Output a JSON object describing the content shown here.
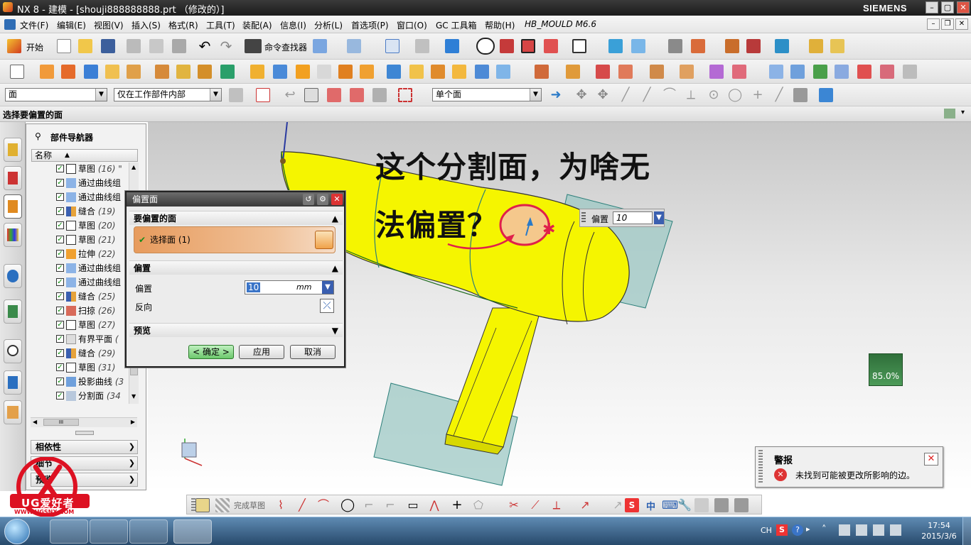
{
  "window": {
    "title": "NX 8 - 建模 - [shouji888888888.prt （修改的）]",
    "brand": "SIEMENS",
    "min": "–",
    "max": "▢",
    "close": "✕"
  },
  "menu": [
    "文件(F)",
    "编辑(E)",
    "视图(V)",
    "插入(S)",
    "格式(R)",
    "工具(T)",
    "装配(A)",
    "信息(I)",
    "分析(L)",
    "首选项(P)",
    "窗口(O)",
    "GC 工具箱",
    "帮助(H)",
    "HB_MOULD M6.6"
  ],
  "toolbar": {
    "start_label": "开始",
    "cmd_finder_label": "命令查找器"
  },
  "selection_bar": {
    "filter_value": "面",
    "scope_value": "仅在工作部件内部",
    "face_rule_value": "单个面"
  },
  "cue_line": "选择要偏置的面",
  "navigator": {
    "title": "部件导航器",
    "column_header": "名称",
    "items": [
      {
        "label": "草图",
        "num": "(16) \""
      },
      {
        "label": "通过曲线组",
        "num": ""
      },
      {
        "label": "通过曲线组",
        "num": ""
      },
      {
        "label": "缝合",
        "num": "(19)"
      },
      {
        "label": "草图",
        "num": "(20)"
      },
      {
        "label": "草图",
        "num": "(21)"
      },
      {
        "label": "拉伸",
        "num": "(22)"
      },
      {
        "label": "通过曲线组",
        "num": ""
      },
      {
        "label": "通过曲线组",
        "num": ""
      },
      {
        "label": "缝合",
        "num": "(25)"
      },
      {
        "label": "扫掠",
        "num": "(26)"
      },
      {
        "label": "草图",
        "num": "(27)"
      },
      {
        "label": "有界平面",
        "num": "("
      },
      {
        "label": "缝合",
        "num": "(29)"
      },
      {
        "label": "草图",
        "num": "(31)"
      },
      {
        "label": "投影曲线",
        "num": "(3"
      },
      {
        "label": "分割面",
        "num": "(34"
      }
    ],
    "hscroll_label": "III",
    "panels": [
      "相依性",
      "细节",
      "预览"
    ]
  },
  "dialog": {
    "title": "偏置面",
    "section_faces": "要偏置的面",
    "select_face_label": "选择面 (1)",
    "section_offset": "偏置",
    "offset_label": "偏置",
    "offset_value": "10",
    "offset_unit": "mm",
    "reverse_label": "反向",
    "section_preview": "预览",
    "ok_label": "< 确定 >",
    "apply_label": "应用",
    "cancel_label": "取消"
  },
  "annotation": {
    "line1": "这个分割面，为啥无",
    "line2": "法偏置？"
  },
  "screen_offset": {
    "label": "偏置",
    "value": "10"
  },
  "perf_badge": "85.0%",
  "alert": {
    "title": "警报",
    "message": "未找到可能被更改所影响的边。"
  },
  "bottom_bar": {
    "finish_sketch": "完成草图",
    "ime": "中"
  },
  "logo": {
    "brand": "UG爱好者",
    "url": "WWW.UGSNX.COM"
  },
  "tray": {
    "lang": "CH",
    "time": "17:54",
    "date": "2015/3/6"
  },
  "colors": {
    "part_yellow": "#f5f500",
    "plane_teal": "#9dc8c4",
    "dialog_select": "#e79b5d",
    "annotation_red": "#e0204a"
  }
}
